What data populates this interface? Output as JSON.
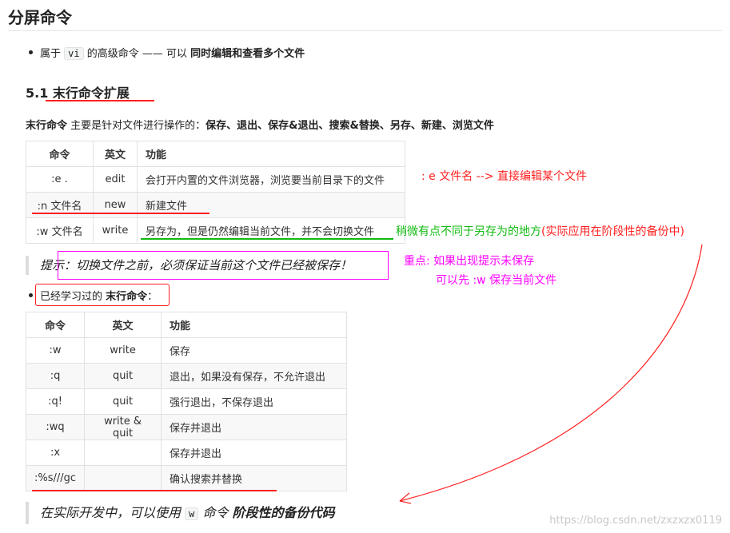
{
  "heading": "分屏命令",
  "intro": {
    "prefix": "属于",
    "code": "vi",
    "middle": "的高级命令 —— 可以",
    "bold": "同时编辑和查看多个文件"
  },
  "section": {
    "title": "5.1 末行命令扩展",
    "desc_bold": "末行命令",
    "desc_rest": "主要是针对文件进行操作的：",
    "desc_ops": "保存、退出、保存&退出、搜索&替换、另存、新建、浏览文件"
  },
  "table1": {
    "headers": [
      "命令",
      "英文",
      "功能"
    ],
    "rows": [
      [
        ":e .",
        "edit",
        "会打开内置的文件浏览器，浏览要当前目录下的文件"
      ],
      [
        ":n 文件名",
        "new",
        "新建文件"
      ],
      [
        ":w 文件名",
        "write",
        "另存为，但是仍然编辑当前文件，并不会切换文件"
      ]
    ]
  },
  "tip": {
    "label": "提示：",
    "text": "切换文件之前，必须保证当前这个文件已经被保存！"
  },
  "learned": {
    "prefix": "已经学习过的",
    "bold": "末行命令",
    "suffix": "："
  },
  "table2": {
    "headers": [
      "命令",
      "英文",
      "功能"
    ],
    "rows": [
      [
        ":w",
        "write",
        "保存"
      ],
      [
        ":q",
        "quit",
        "退出，如果没有保存，不允许退出"
      ],
      [
        ":q!",
        "quit",
        "强行退出，不保存退出"
      ],
      [
        ":wq",
        "write & quit",
        "保存并退出"
      ],
      [
        ":x",
        "",
        "保存并退出"
      ],
      [
        ":%s///gc",
        "",
        "确认搜索并替换"
      ]
    ]
  },
  "bottom_quote": {
    "prefix": "在实际开发中，可以使用",
    "code": "w",
    "middle": "命令",
    "bold": "阶段性的备份代码"
  },
  "annotations": {
    "edit_note": ": e  文件名   -->    直接编辑某个文件",
    "green_note": "稍微有点不同于另存为的地方",
    "red_note": "(实际应用在阶段性的备份中)",
    "mag_note_1": "重点: 如果出现提示未保存",
    "mag_note_2": "可以先 :w 保存当前文件"
  },
  "watermark": "https://blog.csdn.net/zxzxzx0119",
  "colors": {
    "red": "#ff2020",
    "green": "#11bb11",
    "magenta": "#ff00ff",
    "border": "#dfe2e5"
  }
}
